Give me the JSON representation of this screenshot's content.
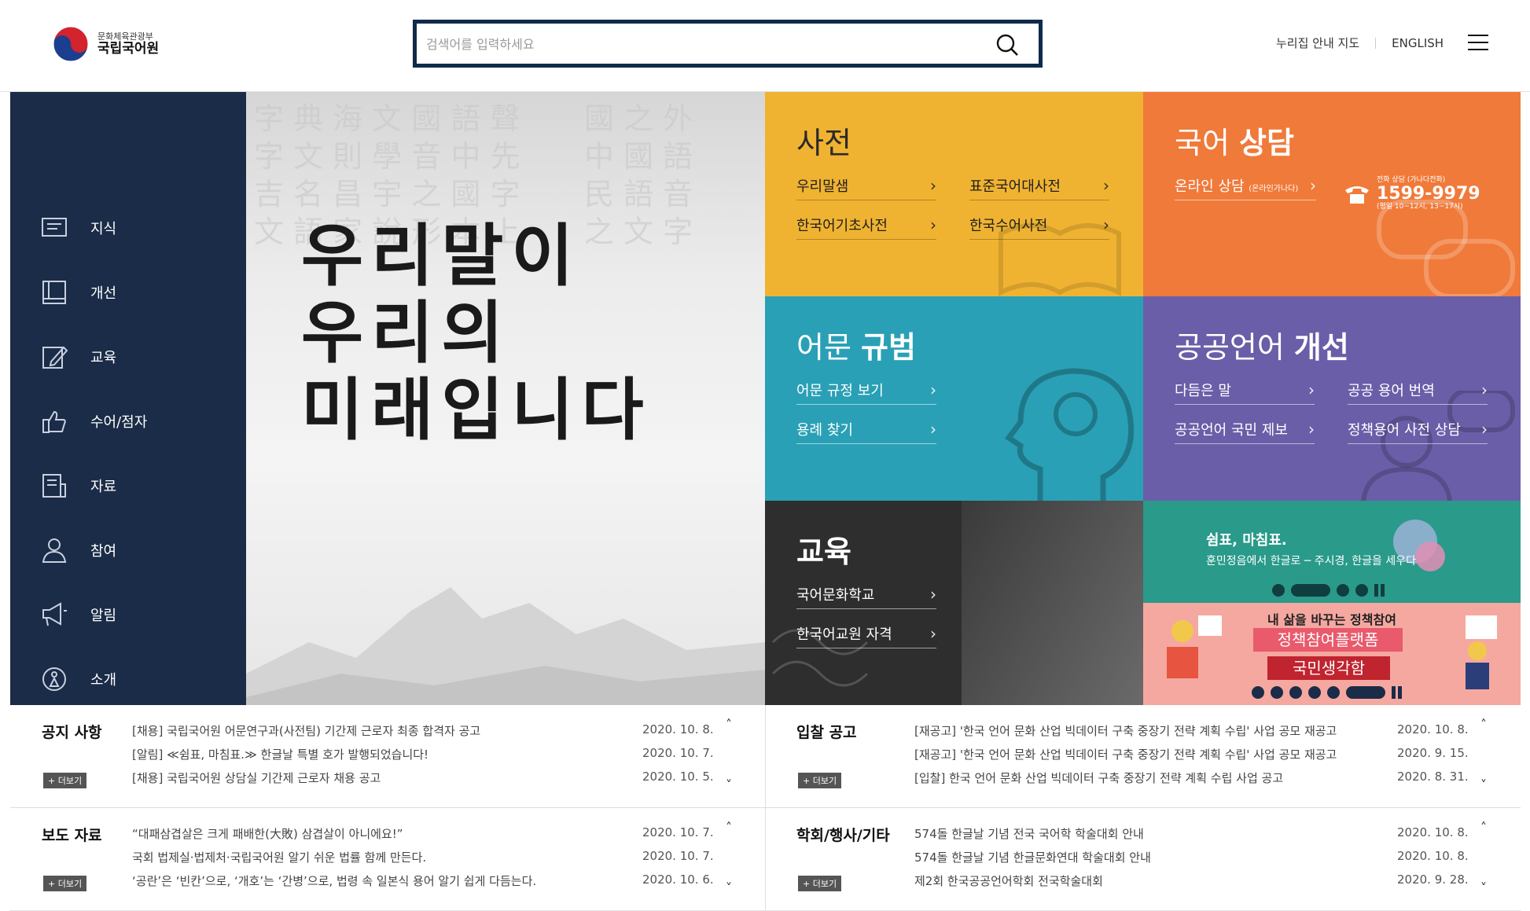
{
  "header": {
    "ministry": "문화체육관광부",
    "org": "국립국어원",
    "search_placeholder": "검색어를 입력하세요",
    "links": [
      "누리집 안내 지도",
      "ENGLISH"
    ]
  },
  "sidebar": {
    "items": [
      {
        "label": "지식",
        "icon": "knowledge-icon"
      },
      {
        "label": "개선",
        "icon": "book-icon"
      },
      {
        "label": "교육",
        "icon": "edit-icon"
      },
      {
        "label": "수어/점자",
        "icon": "hand-icon"
      },
      {
        "label": "자료",
        "icon": "document-icon"
      },
      {
        "label": "참여",
        "icon": "person-icon"
      },
      {
        "label": "알림",
        "icon": "megaphone-icon"
      },
      {
        "label": "소개",
        "icon": "info-icon"
      }
    ]
  },
  "hero": {
    "lines": "우리말이\n우리의\n미래입니다"
  },
  "tiles": {
    "dict": {
      "title": "사전",
      "links": [
        "우리말샘",
        "표준국어대사전",
        "한국어기초사전",
        "한국수어사전"
      ]
    },
    "counsel": {
      "title_a": "국어 ",
      "title_b": "상담",
      "online": "온라인 상담",
      "online_sub": "(온라인가나다)",
      "phone_label": "전화 상담 (가나다전화)",
      "phone": "1599-9979",
      "hours": "(평일 10~12시, 13~17시)"
    },
    "norm": {
      "title_a": "어문 ",
      "title_b": "규범",
      "links": [
        "어문 규정 보기",
        "용례 찾기"
      ]
    },
    "public": {
      "title_a": "공공언어 ",
      "title_b": "개선",
      "links": [
        "다듬은 말",
        "공공 용어 번역",
        "공공언어 국민 제보",
        "정책용어 사전 상담"
      ]
    },
    "edu": {
      "title": "교육",
      "links": [
        "국어문화학교",
        "한국어교원 자격"
      ]
    }
  },
  "banner1": {
    "title": "쉼표, 마침표.",
    "sub": "훈민정음에서 한글로 ─ 주시경, 한글을 세우다"
  },
  "banner2": {
    "top": "내 삶을 바꾸는 정책참여",
    "mid": "정책참여플랫폼",
    "bot": "국민생각함"
  },
  "boards": {
    "notice": {
      "title": "공지 사항",
      "more": "+ 더보기",
      "rows": [
        {
          "text": "[채용] 국립국어원 어문연구과(사전팀) 기간제 근로자 최종 합격자 공고",
          "date": "2020. 10. 8."
        },
        {
          "text": "[알림] ≪쉼표, 마침표.≫ 한글날 특별 호가 발행되었습니다!",
          "date": "2020. 10. 7."
        },
        {
          "text": "[채용] 국립국어원 상담실 기간제 근로자 채용 공고",
          "date": "2020. 10. 5."
        }
      ]
    },
    "bid": {
      "title": "입찰 공고",
      "more": "+ 더보기",
      "rows": [
        {
          "text": "[재공고] '한국 언어 문화 산업 빅데이터 구축 중장기 전략 계획 수립' 사업 공모 재공고",
          "date": "2020. 10. 8."
        },
        {
          "text": "[재공고] '한국 언어 문화 산업 빅데이터 구축 중장기 전략 계획 수립' 사업 공모 재공고",
          "date": "2020. 9. 15."
        },
        {
          "text": "[입찰] 한국 언어 문화 산업 빅데이터 구축 중장기 전략 계획 수립 사업 공고",
          "date": "2020. 8. 31."
        }
      ]
    },
    "press": {
      "title": "보도 자료",
      "more": "+ 더보기",
      "rows": [
        {
          "text": "“대패삼겹살은 크게 패배한(大敗) 삼겹살이 아니에요!”",
          "date": "2020. 10. 7."
        },
        {
          "text": "국회 법제실·법제처·국립국어원 알기 쉬운 법률 함께 만든다.",
          "date": "2020. 10. 7."
        },
        {
          "text": "‘공란’은 ‘빈칸’으로, ‘개호’는 ‘간병’으로, 법령 속 일본식 용어 알기 쉽게 다듬는다.",
          "date": "2020. 10. 6."
        }
      ]
    },
    "event": {
      "title": "학회/행사/기타",
      "more": "+ 더보기",
      "rows": [
        {
          "text": "574돌 한글날 기념 전국 국어학 학술대회 안내",
          "date": "2020. 10. 8."
        },
        {
          "text": "574돌 한글날 기념 한글문화연대 학술대회 안내",
          "date": "2020. 10. 8."
        },
        {
          "text": "제2회 한국공공언어학회 전국학술대회",
          "date": "2020. 9. 28."
        }
      ]
    }
  },
  "colors": {
    "navy": "#1b2c48",
    "dict": "#f0b331",
    "counsel": "#f07a3a",
    "norm": "#2aa0b6",
    "public": "#6a5ea8",
    "edu": "#2e2e2e",
    "banner_teal": "#2a9a8a"
  }
}
